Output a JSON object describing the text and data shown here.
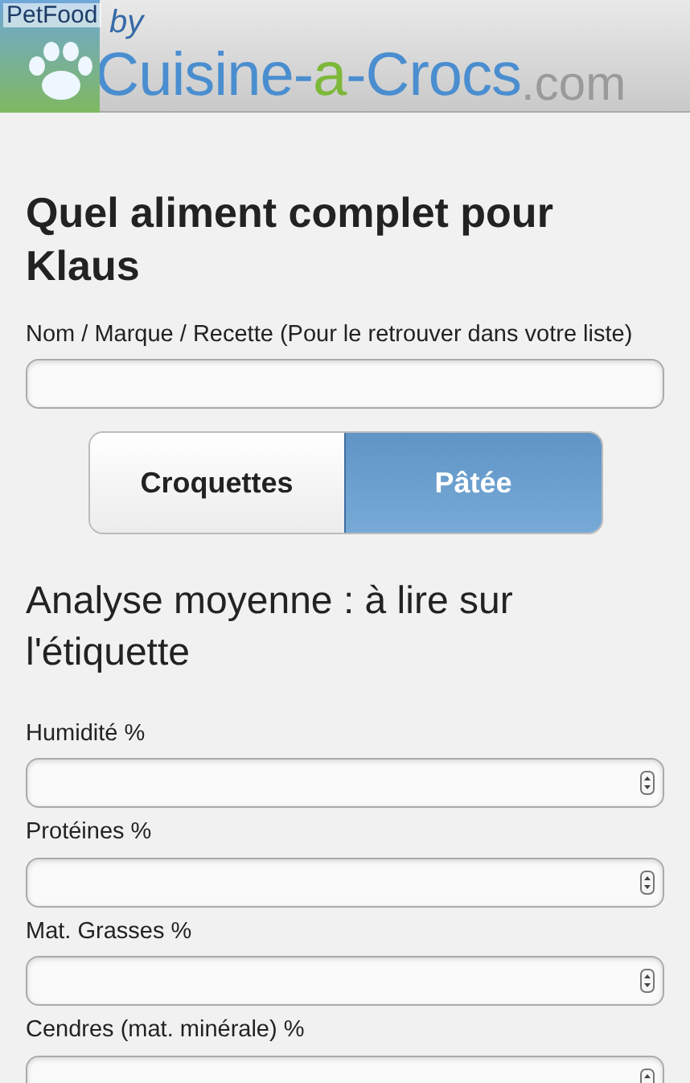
{
  "logo": {
    "badge": "PetFood",
    "by": "by",
    "name": [
      {
        "text": "Cuisine-",
        "accent": false
      },
      {
        "text": "a",
        "accent": true
      },
      {
        "text": "-Crocs",
        "accent": false
      }
    ],
    "domain": ".com"
  },
  "title": "Quel aliment complet pour Klaus",
  "name_field": {
    "label": "Nom / Marque / Recette (Pour le retrouver dans votre liste)"
  },
  "food_type": [
    {
      "label": "Croquettes",
      "selected": false
    },
    {
      "label": "Pâtée",
      "selected": true
    }
  ],
  "analysis_heading": "Analyse moyenne : à lire sur l'étiquette",
  "fields": [
    {
      "label": "Humidité %"
    },
    {
      "label": "Protéines %"
    },
    {
      "label": "Mat. Grasses %"
    },
    {
      "label": "Cendres (mat. minérale) %"
    }
  ]
}
